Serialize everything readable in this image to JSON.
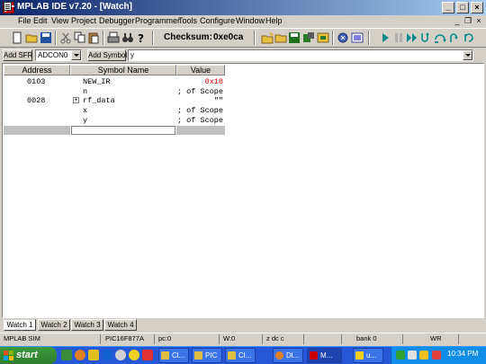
{
  "window": {
    "title": "MPLAB IDE v7.20 - [Watch]"
  },
  "menu": [
    "File",
    "Edit",
    "View",
    "Project",
    "Debugger",
    "Programmer",
    "Tools",
    "Configure",
    "Window",
    "Help"
  ],
  "toolbar": {
    "checksum_label": "Checksum:",
    "checksum_value": "0xe0ca"
  },
  "sfr": {
    "add_sfr_label": "Add SFR",
    "sfr_selected": "ADCON0",
    "add_symbol_label": "Add Symbol",
    "symbol_selected": "y"
  },
  "watch": {
    "columns": {
      "address": "Address",
      "symbol": "Symbol Name",
      "value": "Value"
    },
    "rows": [
      {
        "address": "0103",
        "symbol": "NEW_IR",
        "value": "0x18"
      },
      {
        "address": "",
        "symbol": "n",
        "value": "; of Scope"
      },
      {
        "address": "0028",
        "symbol": "rf_data",
        "value": "\"\""
      },
      {
        "address": "",
        "symbol": "x",
        "value": "; of Scope"
      },
      {
        "address": "",
        "symbol": "y",
        "value": "; of Scope"
      }
    ],
    "expand_glyph": "+",
    "tabs": [
      "Watch 1",
      "Watch 2",
      "Watch 3",
      "Watch 4"
    ]
  },
  "status": {
    "debugger": "MPLAB SIM",
    "device": "PIC16F877A",
    "pc": "pc:0",
    "w": "W:0",
    "flags": "z dc c",
    "bank": "bank 0",
    "mode": "WR"
  },
  "taskbar": {
    "start_label": "start",
    "tasks": [
      {
        "label": "Cl..."
      },
      {
        "label": "PIC"
      },
      {
        "label": "Cl..."
      },
      {
        "label": "Dl..."
      },
      {
        "label": "M..."
      },
      {
        "label": "u..."
      }
    ],
    "clock": "10:34 PM"
  },
  "colors": {
    "title_bar": "#0a246a",
    "value_changed": "#e00000",
    "taskbar": "#2557d6",
    "start_button": "#3c9a3c"
  }
}
